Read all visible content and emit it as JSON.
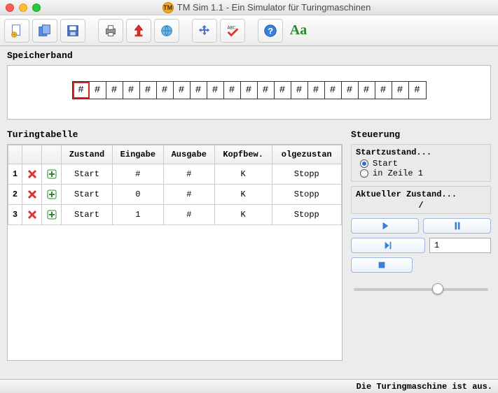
{
  "window": {
    "title": "TM Sim 1.1 - Ein Simulator für Turingmaschinen",
    "badge": "TM"
  },
  "sections": {
    "tape": "Speicherband",
    "table": "Turingtabelle",
    "control": "Steuerung"
  },
  "tape": {
    "cells": [
      "#",
      "#",
      "#",
      "#",
      "#",
      "#",
      "#",
      "#",
      "#",
      "#",
      "#",
      "#",
      "#",
      "#",
      "#",
      "#",
      "#",
      "#",
      "#",
      "#",
      "#"
    ],
    "head_index": 0
  },
  "table": {
    "headers": [
      "",
      "",
      "",
      "Zustand",
      "Eingabe",
      "Ausgabe",
      "Kopfbew.",
      "olgezustan"
    ],
    "rows": [
      {
        "n": "1",
        "zustand": "Start",
        "eingabe": "#",
        "ausgabe": "#",
        "kopf": "K",
        "folge": "Stopp"
      },
      {
        "n": "2",
        "zustand": "Start",
        "eingabe": "0",
        "ausgabe": "#",
        "kopf": "K",
        "folge": "Stopp"
      },
      {
        "n": "3",
        "zustand": "Start",
        "eingabe": "1",
        "ausgabe": "#",
        "kopf": "K",
        "folge": "Stopp"
      }
    ]
  },
  "control": {
    "start_label": "Startzustand...",
    "opt1": "Start",
    "opt2": "in Zeile 1",
    "current_label": "Aktueller Zustand...",
    "current_value": "/",
    "step_value": "1"
  },
  "status": "Die Turingmaschine ist aus.",
  "aa": "Aa"
}
